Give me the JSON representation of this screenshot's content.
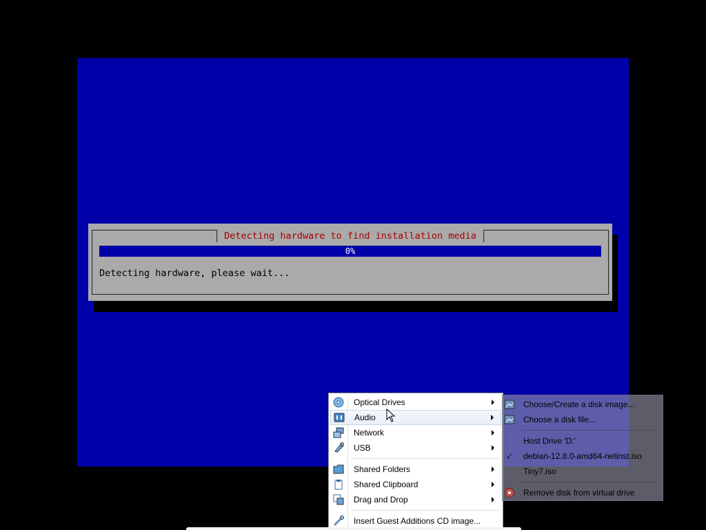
{
  "installer": {
    "title": "Detecting hardware to find installation media",
    "progress_percent": 0,
    "progress_text": "0%",
    "message": "Detecting hardware, please wait..."
  },
  "menu": {
    "items": [
      {
        "label": "Optical Drives",
        "icon": "optical-disc-icon",
        "has_submenu": true
      },
      {
        "label": "Audio",
        "icon": "audio-icon",
        "has_submenu": true
      },
      {
        "label": "Network",
        "icon": "network-icon",
        "has_submenu": true
      },
      {
        "label": "USB",
        "icon": "usb-icon",
        "has_submenu": true
      },
      {
        "label": "Shared Folders",
        "icon": "folder-icon",
        "has_submenu": true
      },
      {
        "label": "Shared Clipboard",
        "icon": "clipboard-icon",
        "has_submenu": true
      },
      {
        "label": "Drag and Drop",
        "icon": "drag-drop-icon",
        "has_submenu": true
      },
      {
        "label": "Insert Guest Additions CD image...",
        "icon": "guest-additions-icon",
        "has_submenu": false
      }
    ]
  },
  "submenu": {
    "items": [
      {
        "label": "Choose/Create a disk image...",
        "icon": "disk-image-icon",
        "checked": false
      },
      {
        "label": "Choose a disk file...",
        "icon": "disk-file-icon",
        "checked": false
      },
      {
        "label": "Host Drive 'D:'",
        "icon": "",
        "checked": false
      },
      {
        "label": "debian-12.8.0-amd64-netinst.iso",
        "icon": "check-icon",
        "checked": true
      },
      {
        "label": "Tiny7.iso",
        "icon": "",
        "checked": false
      },
      {
        "label": "Remove disk from virtual drive",
        "icon": "remove-disk-icon",
        "checked": false
      }
    ]
  },
  "colors": {
    "vm_background": "#0000a8",
    "dialog_background": "#aaaaaa",
    "dialog_title": "#a80000"
  }
}
